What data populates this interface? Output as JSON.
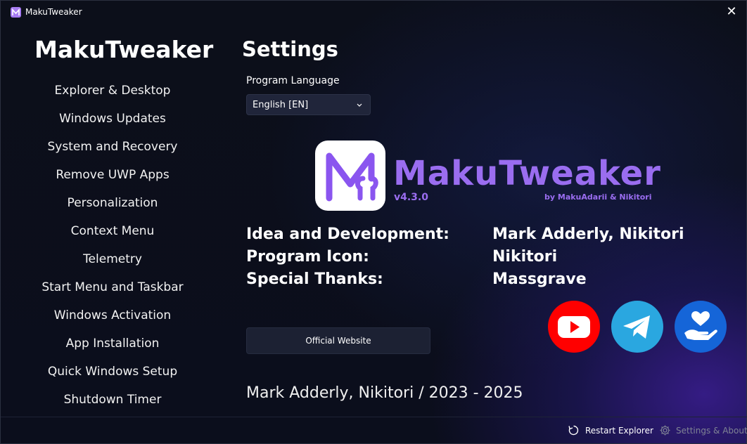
{
  "window": {
    "title": "MakuTweaker"
  },
  "sidebar": {
    "title": "MakuTweaker",
    "items": [
      {
        "label": "Explorer & Desktop"
      },
      {
        "label": "Windows Updates"
      },
      {
        "label": "System and Recovery"
      },
      {
        "label": "Remove UWP Apps"
      },
      {
        "label": "Personalization"
      },
      {
        "label": "Context Menu"
      },
      {
        "label": "Telemetry"
      },
      {
        "label": "Start Menu and Taskbar"
      },
      {
        "label": "Windows Activation"
      },
      {
        "label": "App Installation"
      },
      {
        "label": "Quick Windows Setup"
      },
      {
        "label": "Shutdown Timer"
      }
    ]
  },
  "main": {
    "title": "Settings",
    "language": {
      "label": "Program Language",
      "selected": "English [EN]"
    },
    "brand": {
      "name": "MakuTweaker",
      "version": "v4.3.0",
      "by": "by MakuAdarii & Nikitori"
    },
    "credits": [
      {
        "key": "Idea and Development:",
        "value": "Mark Adderly, Nikitori"
      },
      {
        "key": "Program Icon:",
        "value": "Nikitori"
      },
      {
        "key": "Special Thanks:",
        "value": "Massgrave"
      }
    ],
    "website_button": "Official Website",
    "social": [
      {
        "icon": "youtube-icon",
        "color": "#ff0000"
      },
      {
        "icon": "telegram-icon",
        "color": "#2aa7e0"
      },
      {
        "icon": "donate-icon",
        "color": "#1565d8"
      }
    ],
    "copyright": "Mark Adderly, Nikitori / 2023 - 2025"
  },
  "bottombar": {
    "restart_label": "Restart Explorer",
    "settings_label": "Settings & About"
  },
  "colors": {
    "accent": "#9a6df0",
    "background": "#0b0e1c"
  }
}
